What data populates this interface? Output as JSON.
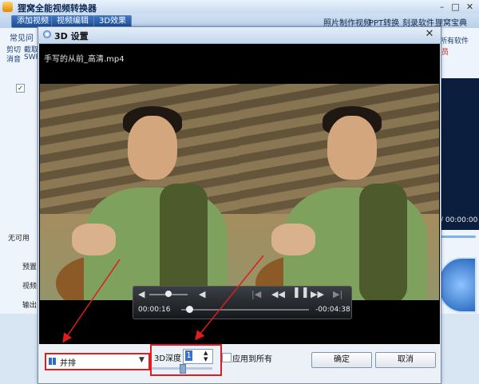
{
  "app": {
    "title": "狸窝全能视频转换器",
    "tabs": [
      "添加视频",
      "视频编辑",
      "3D效果"
    ],
    "top_links": [
      "照片制作视频",
      "PPT转换",
      "刻录软件",
      "狸窝宝典"
    ],
    "left_texts": [
      "常见问",
      "剪切",
      "截取",
      "消音",
      "SWF",
      "无可用",
      "预置",
      "视频",
      "输出"
    ],
    "right_texts": [
      "所有软件",
      "员"
    ],
    "right_time": "/ 00:00:00"
  },
  "dialog": {
    "title": "3D 设置",
    "filename": "手写的从前_高清.mp4",
    "player": {
      "current_time": "00:00:16",
      "remaining_time": "-00:04:38",
      "volume_level": 0.5,
      "progress": 0.06
    },
    "mode_select": {
      "value": "并排"
    },
    "depth": {
      "label": "3D深度",
      "value": "1"
    },
    "apply_all_label": "应用到所有",
    "ok_label": "确定",
    "cancel_label": "取消"
  },
  "colors": {
    "highlight": "#e01c1c",
    "accent": "#1f4f94"
  },
  "icons": [
    "app-logo-icon",
    "minimize-icon",
    "maximize-icon",
    "close-icon",
    "3d-icon",
    "volume-icon",
    "rewind-icon",
    "pause-icon",
    "forward-icon",
    "side-by-side-icon",
    "dropdown-arrow-icon",
    "spin-arrows-icon"
  ]
}
